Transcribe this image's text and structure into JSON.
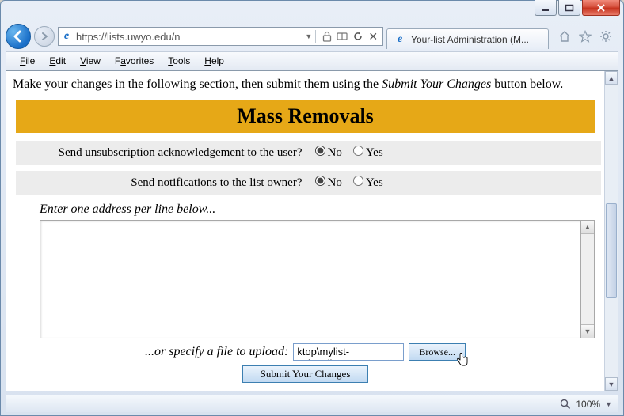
{
  "window": {
    "url_display": "https://lists.uwyo.edu/n",
    "tab_title": "Your-list Administration (M..."
  },
  "menu": {
    "file": "File",
    "edit": "Edit",
    "view": "View",
    "favorites": "Favorites",
    "tools": "Tools",
    "help": "Help"
  },
  "page": {
    "intro_prefix": "Make your changes in the following section, then submit them using the ",
    "intro_em": "Submit Your Changes",
    "intro_suffix": " button below.",
    "section_title": "Mass Removals",
    "options": {
      "ack_label": "Send unsubscription acknowledgement to the user?",
      "notify_label": "Send notifications to the list owner?",
      "no": "No",
      "yes": "Yes",
      "ack_value": "No",
      "notify_value": "No"
    },
    "enter_label": "Enter one address per line below...",
    "addresses": "",
    "upload_label": "...or specify a file to upload:",
    "upload_filename": "ktop\\mylist-subscribers.txt",
    "browse_label": "Browse...",
    "submit_label": "Submit Your Changes"
  },
  "status": {
    "zoom": "100%"
  }
}
